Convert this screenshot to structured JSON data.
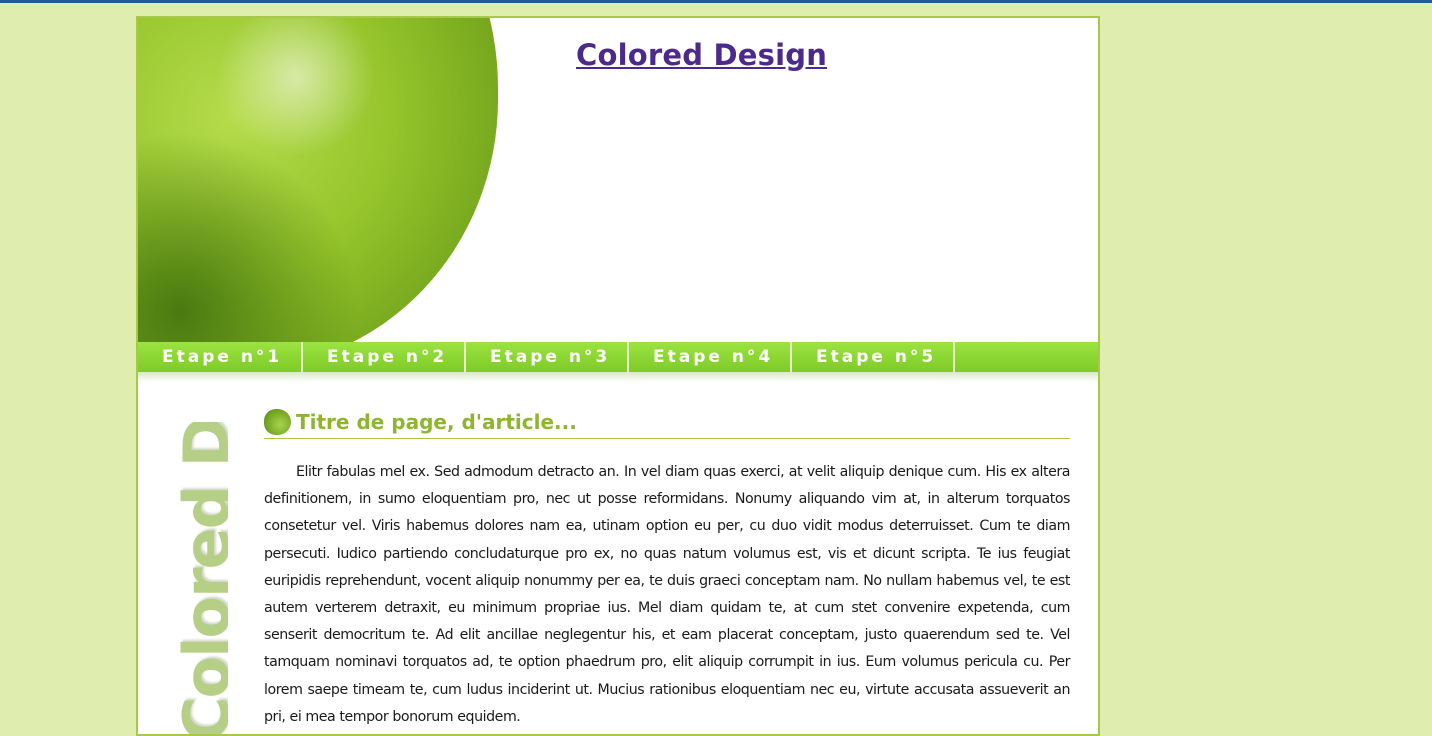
{
  "colors": {
    "background": "#dfeeae",
    "accent_green": "#8fb52e",
    "nav_green": "#8ed634",
    "title_purple": "#4b2a8c"
  },
  "header": {
    "site_title": "Colored Design",
    "image": "green-apple-image"
  },
  "nav": {
    "items": [
      {
        "label": "Etape n°1"
      },
      {
        "label": "Etape n°2"
      },
      {
        "label": "Etape n°3"
      },
      {
        "label": "Etape n°4"
      },
      {
        "label": "Etape n°5"
      }
    ]
  },
  "sidebar": {
    "logo_text": "Colored Design"
  },
  "article": {
    "icon": "apple-icon",
    "title": "Titre de page, d'article...",
    "body": "Elitr fabulas mel ex. Sed admodum detracto an. In vel diam quas exerci, at velit aliquip denique cum. His ex altera definitionem, in sumo eloquentiam pro, nec ut posse reformidans. Nonumy aliquando vim at, in alterum torquatos consetetur vel. Viris habemus dolores nam ea, utinam option eu per, cu duo vidit modus deterruisset. Cum te diam persecuti. Iudico partiendo concludaturque pro ex, no quas natum volumus est, vis et dicunt scripta. Te ius feugiat euripidis reprehendunt, vocent aliquip nonummy per ea, te duis graeci conceptam nam. No nullam habemus vel, te est autem verterem detraxit, eu minimum propriae ius. Mel diam quidam te, at cum stet convenire expetenda, cum senserit democritum te. Ad elit ancillae neglegentur his, et eam placerat conceptam, justo quaerendum sed te. Vel tamquam nominavi torquatos ad, te option phaedrum pro, elit aliquip corrumpit in ius. Eum volumus pericula cu. Per lorem saepe timeam te, cum ludus inciderint ut. Mucius rationibus eloquentiam nec eu, virtute accusata assueverit an pri, ei mea tempor bonorum equidem."
  }
}
